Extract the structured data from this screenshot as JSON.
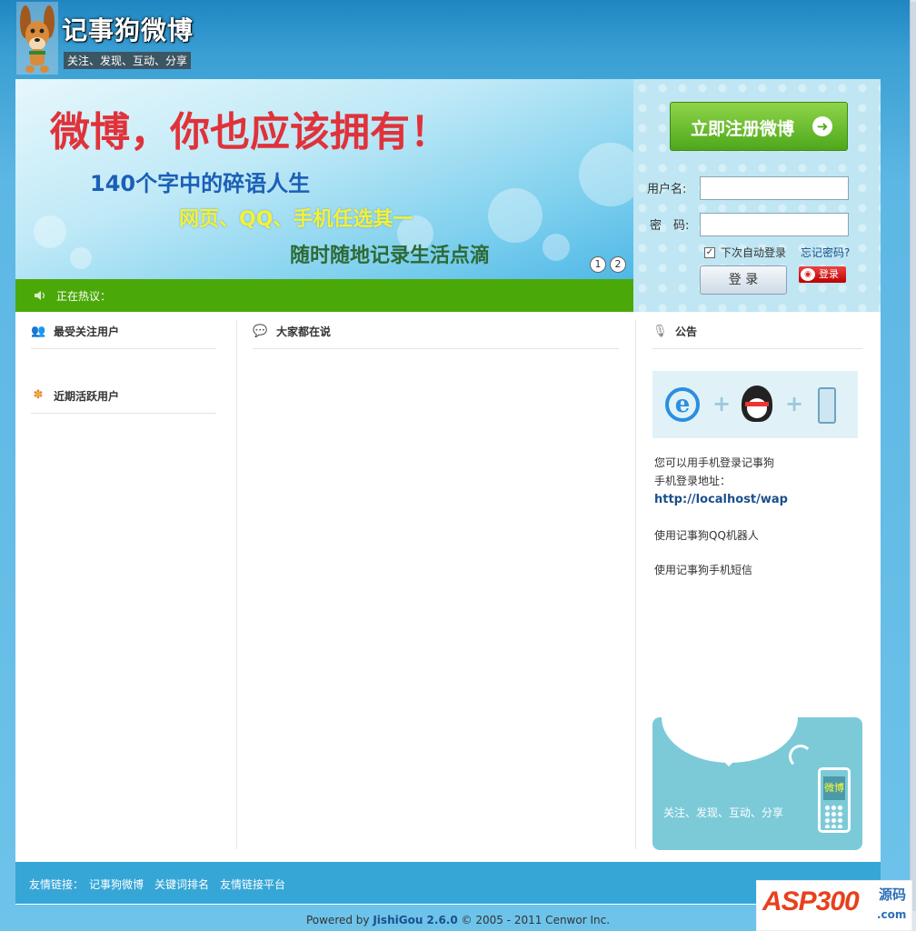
{
  "header": {
    "site_title": "记事狗微博",
    "slogan": "关注、发现、互动、分享"
  },
  "banner": {
    "headline": "微博，你也应该拥有！",
    "line1": "140个字中的碎语人生",
    "line2": "网页、QQ、手机任选其一",
    "line3": "随时随地记录生活点滴",
    "pages": [
      "1",
      "2"
    ]
  },
  "hot": {
    "label": "正在热议："
  },
  "login": {
    "register_label": "立即注册微博",
    "username_label": "用户名:",
    "username_value": "",
    "password_label": "密　码:",
    "password_value": "",
    "auto_login_label": "下次自动登录",
    "auto_login_checked": true,
    "forgot_label": "忘记密码?",
    "login_button": "登 录",
    "weibo_login_label": "登录"
  },
  "panels": {
    "popular_users": "最受关注用户",
    "active_users": "近期活跃用户",
    "everyone_says": "大家都在说",
    "notice": "公告"
  },
  "notice": {
    "mobile_login": "您可以用手机登录记事狗",
    "mobile_address_label": "手机登录地址：",
    "mobile_address": "http://localhost/wap",
    "qq_robot": "使用记事狗QQ机器人",
    "sms": "使用记事狗手机短信",
    "card_screen": "微博",
    "card_slogan": "关注、发现、互动、分享"
  },
  "footer": {
    "links_label": "友情链接：",
    "links": [
      "记事狗微博",
      "关键词排名",
      "友情链接平台"
    ],
    "powered_prefix": "Powered by ",
    "powered_product": "JishiGou 2.6.0",
    "powered_suffix": " © 2005 - 2011 Cenwor Inc."
  },
  "watermark": {
    "brand": "ASP300",
    "cn": "源码",
    "domain": ".com"
  },
  "colors": {
    "hot_bar": "#4aa809",
    "register": "#4ea81b",
    "headline": "#e0323a",
    "link": "#1b4f8a"
  }
}
